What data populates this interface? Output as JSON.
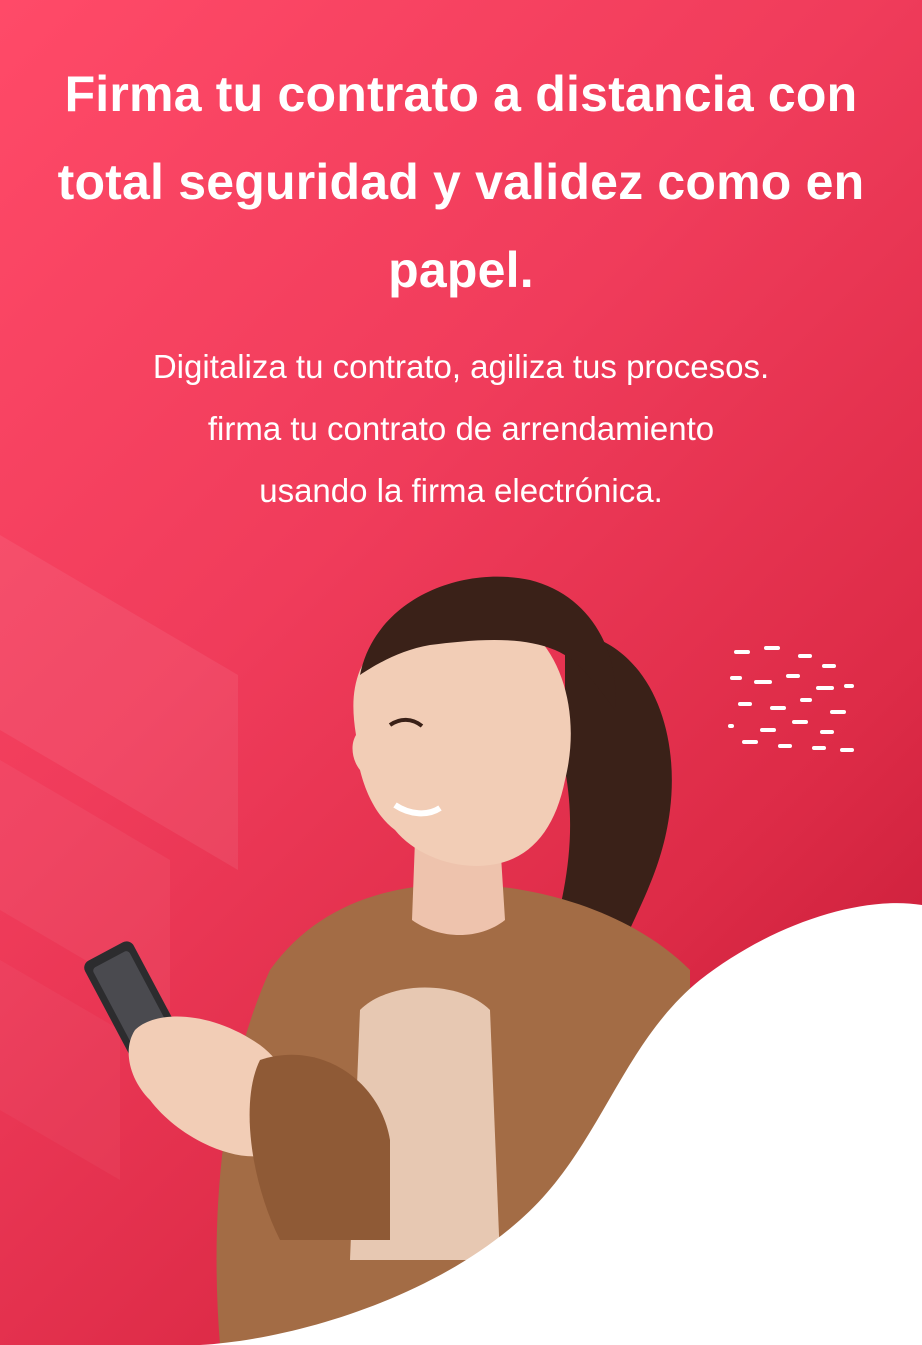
{
  "hero": {
    "headline": "Firma tu contrato a distancia con total seguridad y validez como en papel.",
    "subtext": "Digitaliza tu contrato, agiliza tus procesos.\nfirma tu contrato de arrendamiento\nusando la firma electrónica."
  },
  "illustration": {
    "subject": "woman-smiling-using-smartphone-icon",
    "decor": "dash-pattern-icon"
  },
  "colors": {
    "gradient_start": "#ff4a68",
    "gradient_end": "#bb1430",
    "text": "#ffffff",
    "wave": "#ffffff"
  }
}
